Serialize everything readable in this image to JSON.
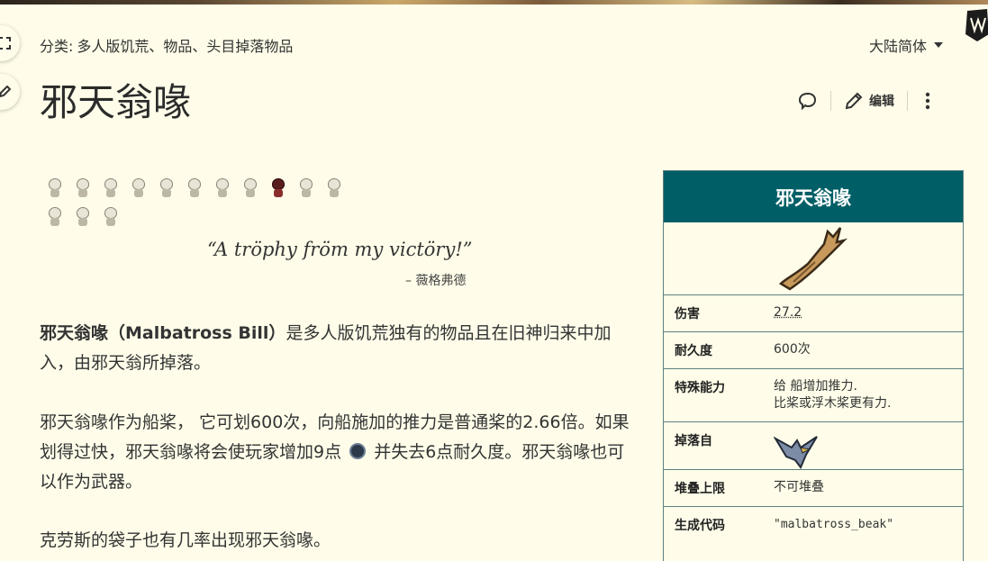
{
  "header": {
    "categories_label": "分类:",
    "categories": "多人版饥荒、物品、头目掉落物品",
    "language": "大陆简体",
    "title": "邪天翁喙",
    "edit_label": "编辑"
  },
  "quote": {
    "text": "“A tröphy fröm my victöry!”",
    "author": "– 薇格弗德"
  },
  "article": {
    "p1_bold": "邪天翁喙（Malbatross Bill）",
    "p1_rest": "是多人版饥荒独有的物品且在旧神归来中加入，由邪天翁所掉落。",
    "p2_a": "邪天翁喙作为船桨， 它可划600次，向船施加的推力是普通桨的2.66倍。如果划得过快，邪天翁喙将会使玩家增加9点",
    "p2_b": "并失去6点耐久度。邪天翁喙也可以作为武器。",
    "p3": "克劳斯的袋子也有几率出现邪天翁喙。"
  },
  "infobox": {
    "title": "邪天翁喙",
    "rows": [
      {
        "key": "伤害",
        "value": "27.2"
      },
      {
        "key": "耐久度",
        "value": "600次"
      },
      {
        "key": "特殊能力",
        "value_line1": "给 船增加推力.",
        "value_line2": "比桨或浮木桨更有力."
      },
      {
        "key": "掉落自",
        "value": ""
      },
      {
        "key": "堆叠上限",
        "value": "不可堆叠"
      },
      {
        "key": "生成代码",
        "value": "\"malbatross_beak\""
      }
    ]
  },
  "icons": {
    "comment": "speech-bubble-icon",
    "edit": "pencil-icon",
    "more": "vertical-dots-icon",
    "sanity": "sanity-icon"
  },
  "colors": {
    "background": "#fffde9",
    "infobox_header": "#005e66",
    "text": "#333333"
  }
}
